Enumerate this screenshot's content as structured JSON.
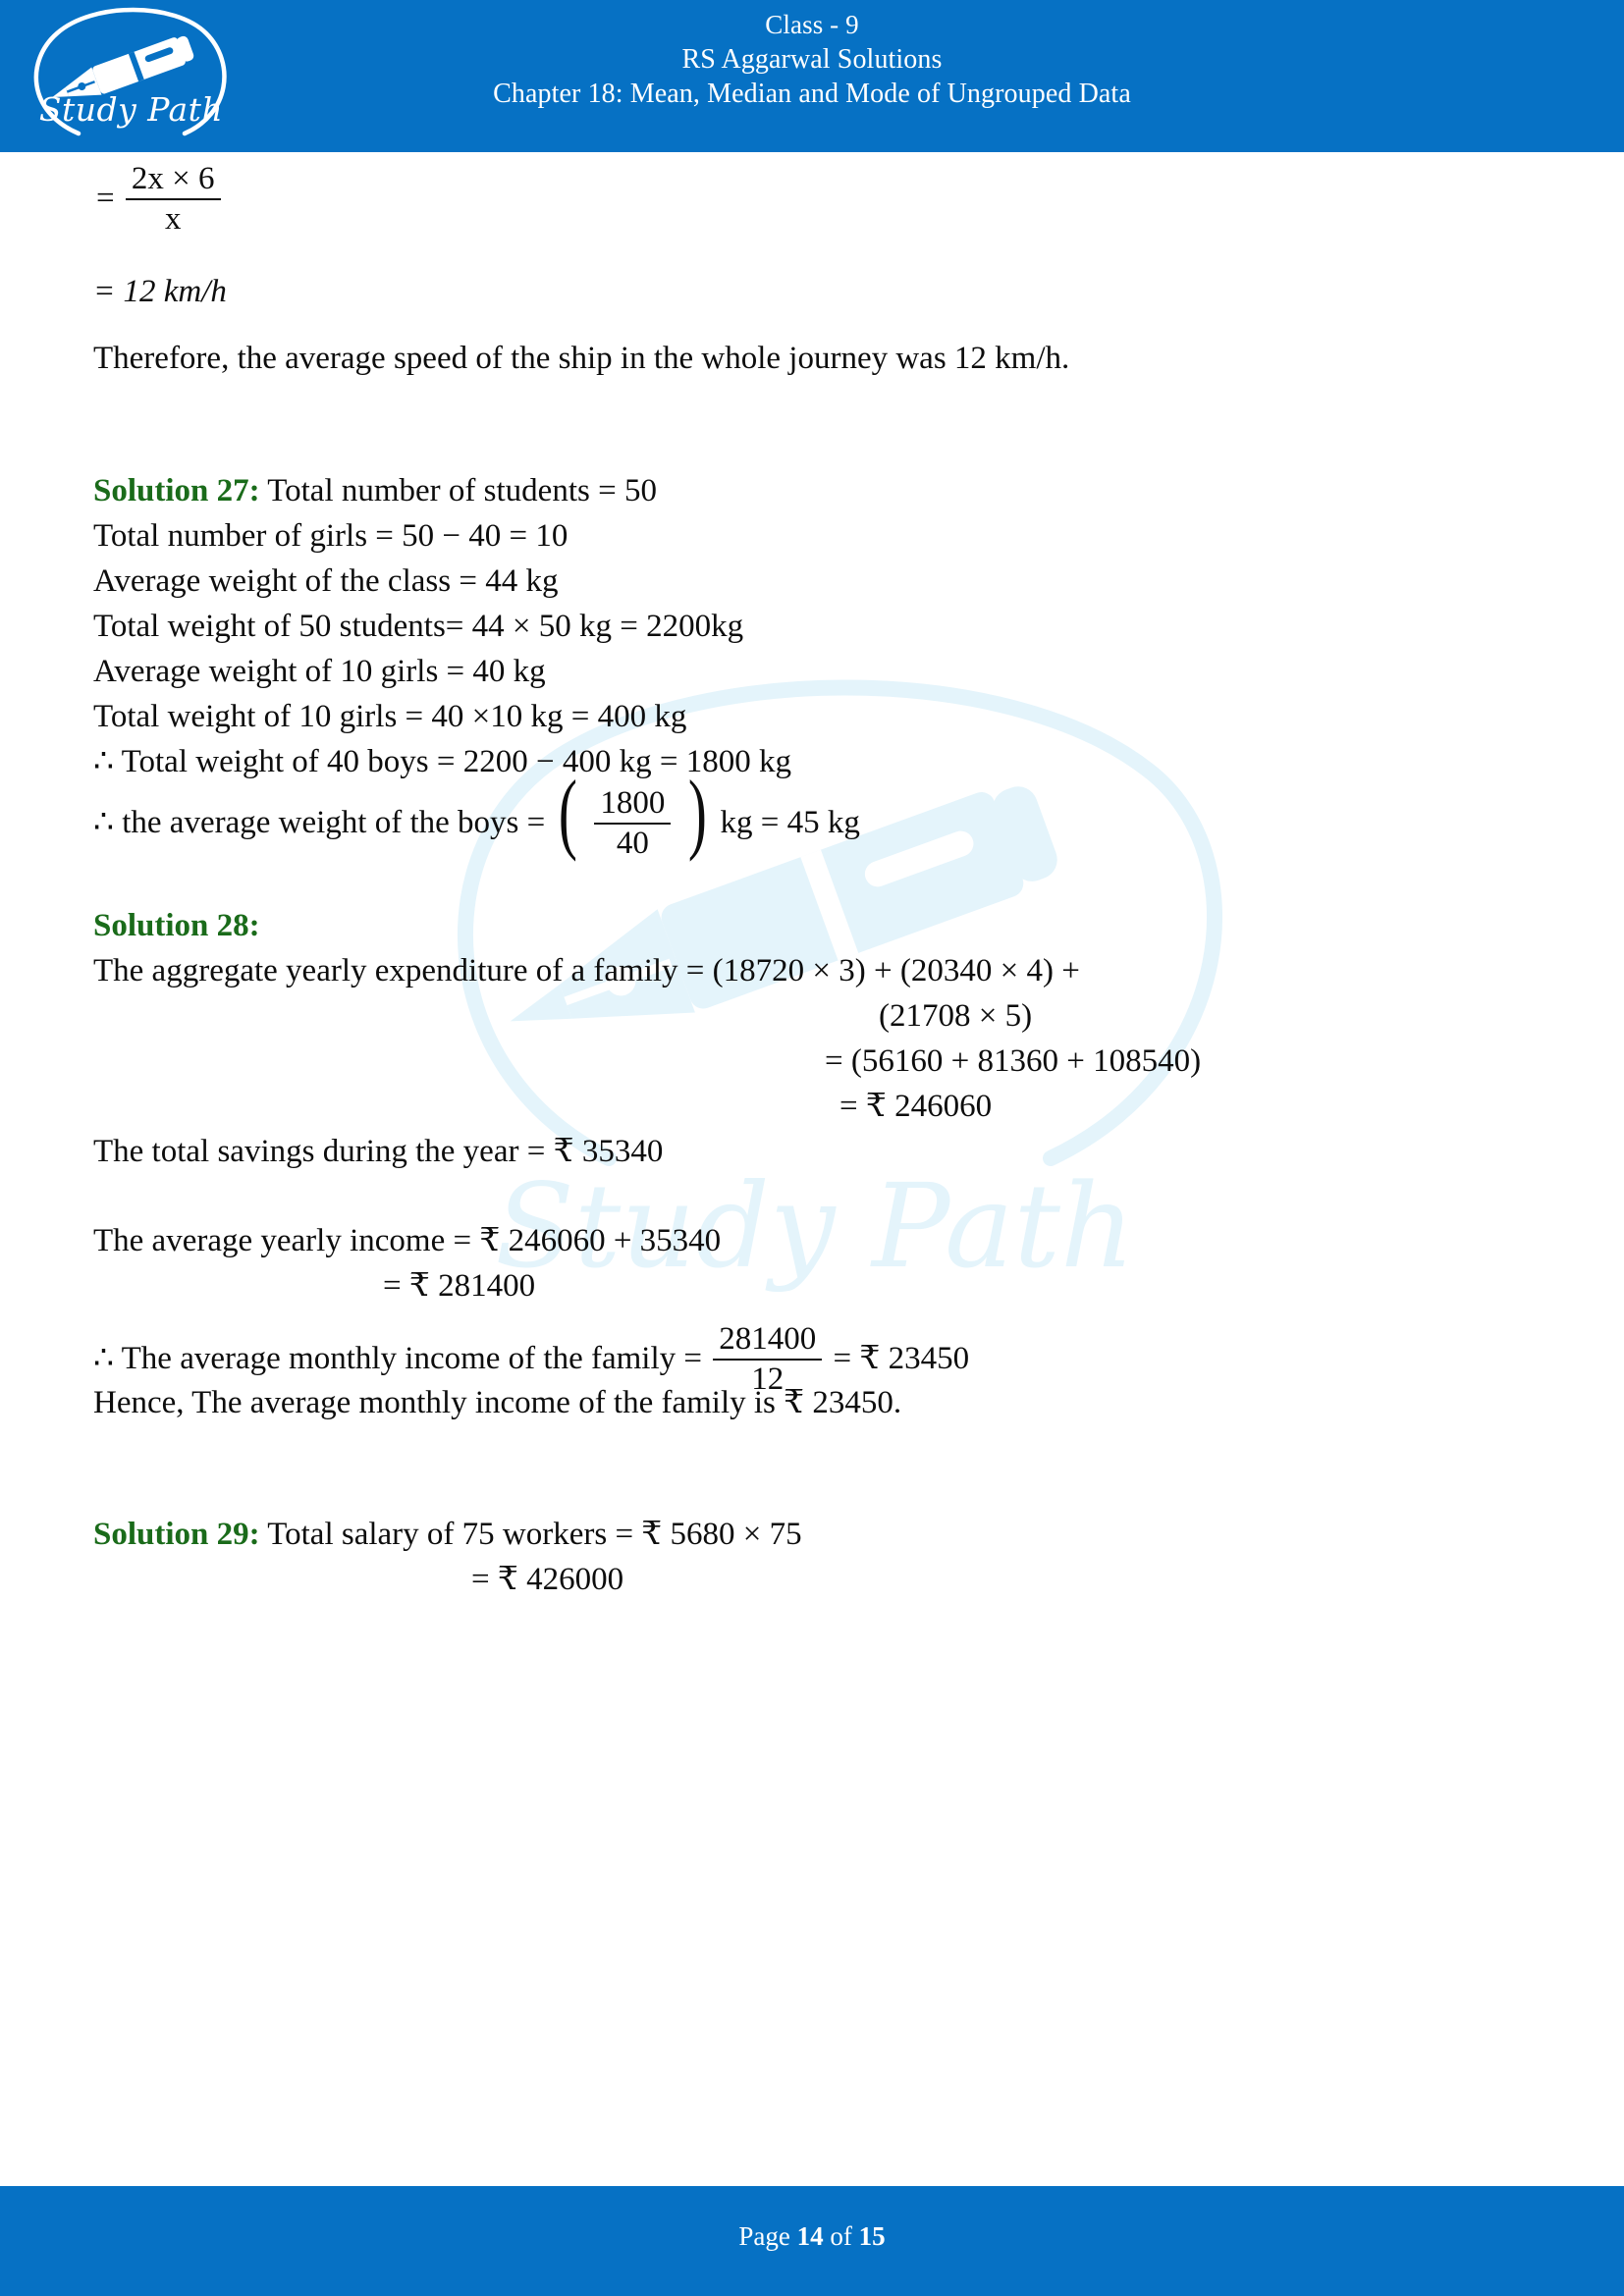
{
  "header": {
    "logo_text": "Study Path",
    "logo_icon": "fountain-pen-icon",
    "line1": "Class - 9",
    "line2": "RS Aggarwal Solutions",
    "line3": "Chapter 18: Mean, Median and Mode of Ungrouped Data",
    "background_color": "#0671c4",
    "text_color": "#ffffff"
  },
  "watermark": {
    "text": "Study Path",
    "color": "#e4f4fb"
  },
  "body": {
    "accent_green": "#1a6b1a",
    "q26_tail": {
      "frac_eq": "=",
      "frac_num": "2x × 6",
      "frac_den": "x",
      "result": "= 12 km/h",
      "conclusion": "Therefore, the average speed of the ship in the whole journey was 12 km/h."
    },
    "solution27": {
      "label": "Solution 27:",
      "l1": "Total number of students = 50",
      "l2": "Total number of girls = 50 − 40 = 10",
      "l3": "Average weight of the class = 44 kg",
      "l4": "Total weight of 50 students= 44 × 50 kg = 2200kg",
      "l5": "Average weight of 10 girls = 40 kg",
      "l6": "Total weight of 10 girls = 40 ×10 kg = 400 kg",
      "l7": "∴ Total weight of 40 boys = 2200 − 400 kg = 1800 kg",
      "l8_pre": "∴ the average weight of the boys  =",
      "l8_num": "1800",
      "l8_den": "40",
      "l8_post": "kg = 45 kg"
    },
    "solution28": {
      "label": "Solution 28:",
      "l1": "The aggregate yearly expenditure of a family = (18720 × 3) + (20340 × 4) +",
      "l2": "(21708 × 5)",
      "l3": "=  (56160 + 81360 + 108540)",
      "l4": "=  ₹  246060",
      "l5": "The total savings during the year = ₹ 35340",
      "l6": "The average yearly income = ₹ 246060 + 35340",
      "l7": "= ₹ 281400",
      "l8_pre": "∴  The average monthly income of the family  =",
      "l8_num": "281400",
      "l8_den": "12",
      "l8_post": "= ₹ 23450",
      "l9": "Hence, The average monthly income of the family is ₹ 23450."
    },
    "solution29": {
      "label": "Solution 29:",
      "l1": "Total salary of 75 workers = ₹ 5680 × 75",
      "l2": "= ₹ 426000"
    }
  },
  "footer": {
    "prefix": "Page ",
    "current_page": "14",
    "middle": " of ",
    "total_pages": "15",
    "background_color": "#0671c4"
  }
}
